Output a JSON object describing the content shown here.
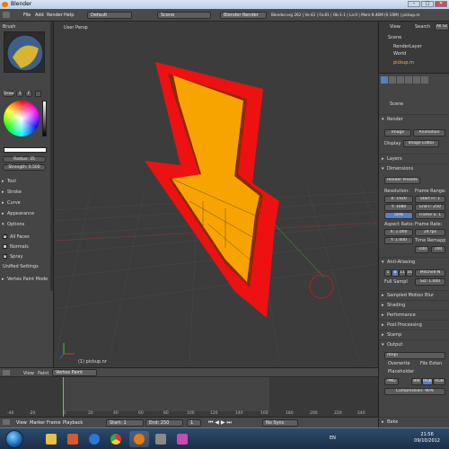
{
  "window": {
    "title": "Blender",
    "min": "–",
    "max": "□",
    "close": "✕"
  },
  "info_bar": {
    "menus": [
      "File",
      "Add",
      "Render",
      "Help"
    ],
    "layout": "Default",
    "scene": "Scene",
    "engine": "Blender Render",
    "stats": "Blender.org 262 | Ve:42 | Fa:81 | Ob:1-1 | La:0 | Mem:9.46M (0.16M) | pickup.m"
  },
  "left_panel": {
    "brush_header": "Brush",
    "brush_mode": "Draw",
    "brush_num": "3",
    "brush_f": "F",
    "radius": "Radius: 35",
    "strength": "Strength: 0.500",
    "sections": {
      "tool": "Tool",
      "stroke": "Stroke",
      "curve": "Curve",
      "appearance": "Appearance",
      "options": "Options"
    },
    "options": {
      "all_faces": "All Faces",
      "normals": "Normals",
      "spray": "Spray"
    },
    "unified": "Unified Settings",
    "vertex_paint_mode": "Vertex Paint Mode"
  },
  "viewport": {
    "label": "User Persp",
    "object_label": "(1) pickup.nr"
  },
  "right_panel": {
    "outliner_header": {
      "view": "View",
      "search": "Search",
      "all": "All Sc"
    },
    "outliner_items": [
      "Scene",
      "RenderLayer",
      "World",
      "pickup.m"
    ],
    "scene_name": "Scene",
    "render_header": "Render",
    "image_btn": "Image",
    "animation_btn": "Animation",
    "display_label": "Display",
    "display_value": "Image Editor",
    "layers": "Layers",
    "dimensions": "Dimensions",
    "render_presets": "Render Presets",
    "resolution": "Resolution:",
    "frame_range": "Frame Range:",
    "res_x": "X: 1920",
    "res_y": "Y: 1080",
    "res_pct": "50%",
    "start_fr": "Start Fr: 1",
    "end_fr": "End F: 250",
    "frame_step": "Frame S: 1",
    "aspect_ratio": "Aspect Ratio:",
    "frame_rate": "Frame Rate:",
    "asp_x": "X: 1.000",
    "asp_y": "Y: 1.000",
    "fps": "24 fps",
    "time_remap": "Time Remapp",
    "remap_old": "-100",
    "remap_new": "100",
    "anti_aliasing": "Anti-Aliasing",
    "aa_samples": [
      "5",
      "8",
      "11",
      "16"
    ],
    "aa_filter": "Mitchell-N",
    "full_sample": "Full Sampl",
    "aa_size": "Siz: 1.000",
    "sampled_motion_blur": "Sampled Motion Blur",
    "shading": "Shading",
    "performance": "Performance",
    "post_processing": "Post Processing",
    "stamp": "Stamp",
    "output": "Output",
    "output_path": "/tmp\\",
    "overwrite": "Overwrite",
    "file_ext": "File Exten",
    "placeholders": "Placeholder",
    "format": "PNG",
    "color_modes": [
      "BW",
      "RGB",
      "RGB"
    ],
    "compression": "Compression: 90%",
    "bake": "Bake"
  },
  "timeline": {
    "header_items": [
      "View",
      "Paint"
    ],
    "mode": "Vertex Paint",
    "ruler": [
      "-40",
      "-20",
      "0",
      "20",
      "40",
      "60",
      "80",
      "100",
      "120",
      "140",
      "160",
      "180",
      "200",
      "220",
      "240",
      "260",
      "280"
    ],
    "bar_items": [
      "View",
      "Marker",
      "Frame",
      "Playback"
    ],
    "start": "Start: 1",
    "end": "End: 250",
    "current": "1",
    "sync": "No Sync"
  },
  "taskbar": {
    "lang": "EN",
    "time": "21:56",
    "date": "09/10/2012"
  },
  "colors": {
    "bolt_outline": "#ee1111",
    "bolt_fill": "#f7a400",
    "bolt_dark": "#8a2a00",
    "accent": "#5680c2"
  }
}
